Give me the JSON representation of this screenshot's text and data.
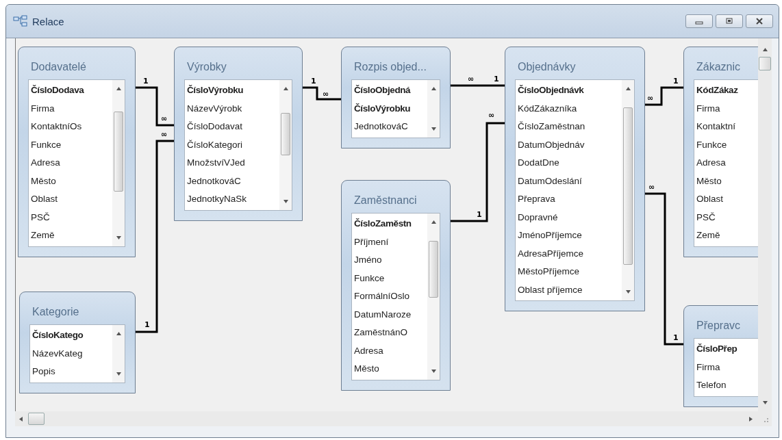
{
  "window": {
    "title": "Relace"
  },
  "tables": [
    {
      "name": "Dodavatelé",
      "fields": [
        {
          "name": "ČísloDodava",
          "key": true
        },
        {
          "name": "Firma",
          "key": false
        },
        {
          "name": "KontaktníOs",
          "key": false
        },
        {
          "name": "Funkce",
          "key": false
        },
        {
          "name": "Adresa",
          "key": false
        },
        {
          "name": "Město",
          "key": false
        },
        {
          "name": "Oblast",
          "key": false
        },
        {
          "name": "PSČ",
          "key": false
        },
        {
          "name": "Země",
          "key": false
        }
      ]
    },
    {
      "name": "Výrobky",
      "fields": [
        {
          "name": "ČísloVýrobku",
          "key": true
        },
        {
          "name": "NázevVýrobk",
          "key": false
        },
        {
          "name": "ČísloDodavat",
          "key": false
        },
        {
          "name": "ČísloKategori",
          "key": false
        },
        {
          "name": "MnožstvíVJed",
          "key": false
        },
        {
          "name": "JednotkováC",
          "key": false
        },
        {
          "name": "JednotkyNaSk",
          "key": false
        }
      ]
    },
    {
      "name": "Rozpis objed...",
      "fields": [
        {
          "name": "ČísloObjedná",
          "key": true
        },
        {
          "name": "ČísloVýrobku",
          "key": true
        },
        {
          "name": "JednotkováC",
          "key": false
        }
      ]
    },
    {
      "name": "Objednávky",
      "fields": [
        {
          "name": "ČísloObjednávk",
          "key": true
        },
        {
          "name": "KódZákazníka",
          "key": false
        },
        {
          "name": "ČísloZaměstnan",
          "key": false
        },
        {
          "name": "DatumObjednáv",
          "key": false
        },
        {
          "name": "DodatDne",
          "key": false
        },
        {
          "name": "DatumOdeslání",
          "key": false
        },
        {
          "name": "Přeprava",
          "key": false
        },
        {
          "name": "Dopravné",
          "key": false
        },
        {
          "name": "JménoPříjemce",
          "key": false
        },
        {
          "name": "AdresaPříjemce",
          "key": false
        },
        {
          "name": "MěstoPříjemce",
          "key": false
        },
        {
          "name": "Oblast příjemce",
          "key": false
        }
      ]
    },
    {
      "name": "Zákaznic",
      "fields": [
        {
          "name": "KódZákaz",
          "key": true
        },
        {
          "name": "Firma",
          "key": false
        },
        {
          "name": "Kontaktní",
          "key": false
        },
        {
          "name": "Funkce",
          "key": false
        },
        {
          "name": "Adresa",
          "key": false
        },
        {
          "name": "Město",
          "key": false
        },
        {
          "name": "Oblast",
          "key": false
        },
        {
          "name": "PSČ",
          "key": false
        },
        {
          "name": "Země",
          "key": false
        }
      ]
    },
    {
      "name": "Kategorie",
      "fields": [
        {
          "name": "ČísloKatego",
          "key": true
        },
        {
          "name": "NázevKateg",
          "key": false
        },
        {
          "name": "Popis",
          "key": false
        }
      ]
    },
    {
      "name": "Zaměstnanci",
      "fields": [
        {
          "name": "ČísloZaměstn",
          "key": true
        },
        {
          "name": "Příjmení",
          "key": false
        },
        {
          "name": "Jméno",
          "key": false
        },
        {
          "name": "Funkce",
          "key": false
        },
        {
          "name": "FormálníOslo",
          "key": false
        },
        {
          "name": "DatumNaroze",
          "key": false
        },
        {
          "name": "ZaměstnánO",
          "key": false
        },
        {
          "name": "Adresa",
          "key": false
        },
        {
          "name": "Město",
          "key": false
        }
      ]
    },
    {
      "name": "Přepravc",
      "fields": [
        {
          "name": "ČísloPřep",
          "key": true
        },
        {
          "name": "Firma",
          "key": false
        },
        {
          "name": "Telefon",
          "key": false
        }
      ]
    }
  ],
  "relationships": [
    {
      "one": "1",
      "many": "∞"
    },
    {
      "one": "1",
      "many": "∞"
    },
    {
      "one": "1",
      "many": "∞"
    },
    {
      "one": "1",
      "many": "∞"
    },
    {
      "one": "1",
      "many": "∞"
    },
    {
      "one": "1",
      "many": "∞"
    },
    {
      "one": "1",
      "many": "∞"
    }
  ]
}
